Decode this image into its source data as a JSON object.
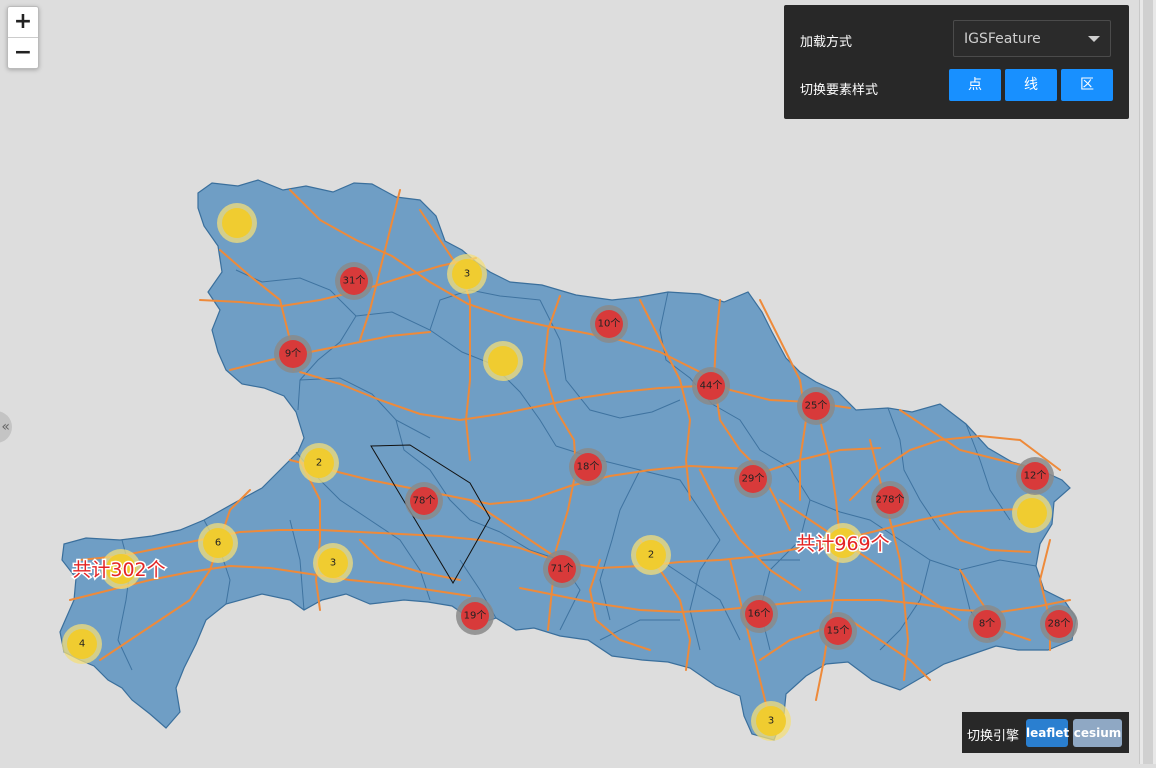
{
  "zoom": {
    "in_label": "+",
    "out_label": "−"
  },
  "panel": {
    "load_label": "加载方式",
    "load_value": "IGSFeature",
    "style_label": "切换要素样式",
    "style_buttons": [
      "点",
      "线",
      "区"
    ]
  },
  "engine": {
    "label": "切换引擎",
    "leaflet": "leaflet",
    "cesium": "cesium"
  },
  "side_handle": {
    "icon": "«"
  },
  "colors": {
    "province_fill": "#6f9ec5",
    "border": "#3a6f9c",
    "road": "#ee8a3a",
    "cluster_red": "#d83a3a",
    "cluster_yellow": "#f0cc30"
  },
  "clusters_red": [
    {
      "label": "31个"
    },
    {
      "label": "9个"
    },
    {
      "label": "10个"
    },
    {
      "label": "44个"
    },
    {
      "label": "25个"
    },
    {
      "label": "18个"
    },
    {
      "label": "29个"
    },
    {
      "label": "78个"
    },
    {
      "label": "278个"
    },
    {
      "label": "12个"
    },
    {
      "label": "71个"
    },
    {
      "label": "19个"
    },
    {
      "label": "16个"
    },
    {
      "label": "15个"
    },
    {
      "label": "8个"
    },
    {
      "label": "28个"
    }
  ],
  "clusters_yellow": [
    {
      "label": ""
    },
    {
      "label": "3"
    },
    {
      "label": ""
    },
    {
      "label": "2"
    },
    {
      "label": "6"
    },
    {
      "label": "3"
    },
    {
      "label": "2"
    },
    {
      "label": ""
    },
    {
      "label": ""
    },
    {
      "label": ""
    },
    {
      "label": "4"
    },
    {
      "label": "3"
    }
  ],
  "totals": [
    {
      "label": "共计302个"
    },
    {
      "label": "共计969个"
    }
  ]
}
